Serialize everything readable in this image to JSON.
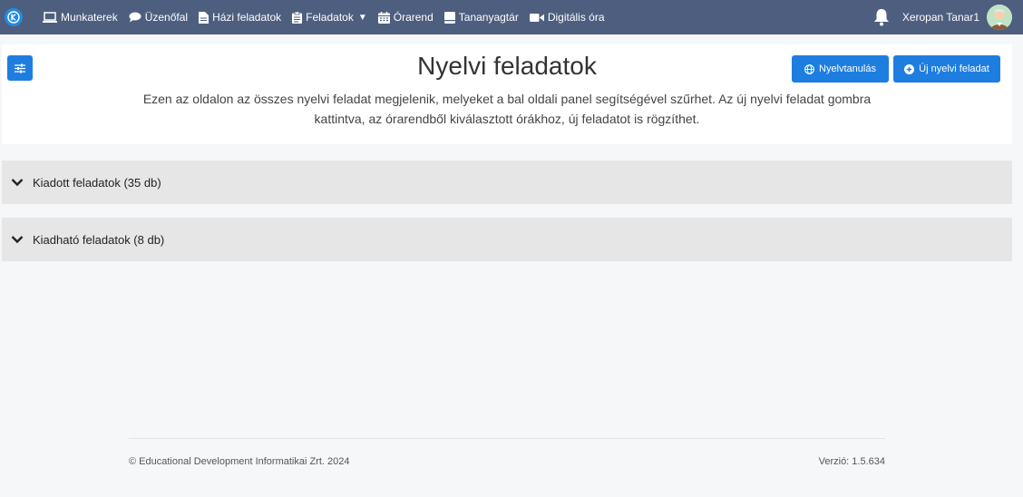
{
  "topbar": {
    "nav": [
      {
        "label": "Munkaterek",
        "icon": "laptop-icon"
      },
      {
        "label": "Üzenőfal",
        "icon": "chat-bubble-icon"
      },
      {
        "label": "Házi feladatok",
        "icon": "document-icon"
      },
      {
        "label": "Feladatok",
        "icon": "clipboard-icon",
        "has_dropdown": true
      },
      {
        "label": "Órarend",
        "icon": "calendar-icon"
      },
      {
        "label": "Tananyagtár",
        "icon": "book-icon"
      },
      {
        "label": "Digitális óra",
        "icon": "video-camera-icon"
      }
    ],
    "user_name": "Xeropan Tanar1",
    "colors": {
      "bar": "#4e5e7e",
      "logo": "#1f8de6"
    }
  },
  "header": {
    "title": "Nyelvi feladatok",
    "description": "Ezen az oldalon az összes nyelvi feladat megjelenik, melyeket a bal oldali panel segítségével szűrhet. Az új nyelvi feladat gombra kattintva, az órarendből kiválasztott órákhoz, új feladatot is rögzíthet.",
    "buttons": {
      "language_learning": "Nyelvtanulás",
      "new_task": "Új nyelvi feladat"
    },
    "colors": {
      "primary": "#1e7ee0"
    }
  },
  "sections": [
    {
      "label": "Kiadott feladatok (35 db)"
    },
    {
      "label": "Kiadható feladatok (8 db)"
    }
  ],
  "footer": {
    "copyright": "© Educational Development Informatikai Zrt. 2024",
    "version": "Verzió: 1.5.634"
  }
}
